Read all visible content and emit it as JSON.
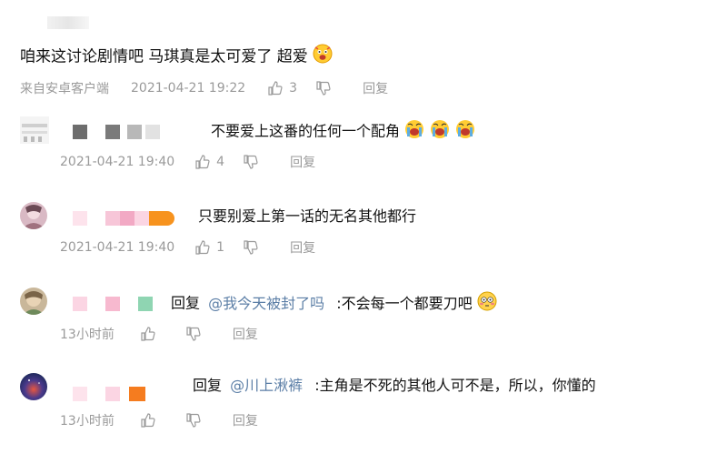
{
  "top_comment": {
    "text": "咱来这讨论剧情吧 马琪真是太可爱了 超爱",
    "emoji": "excited-face-emoji",
    "source": "来自安卓客户端",
    "time": "2021-04-21 19:22",
    "likes": "3",
    "reply_label": "回复"
  },
  "replies": [
    {
      "text": "不要爱上这番的任何一个配角",
      "emoji": "crying-face-emoji",
      "time": "2021-04-21 19:40",
      "likes": "4",
      "reply_label": "回复"
    },
    {
      "text": "只要别爱上第一话的无名其他都行",
      "time": "2021-04-21 19:40",
      "likes": "1",
      "reply_label": "回复"
    },
    {
      "prefix": "回复",
      "mention": "@我今天被封了吗",
      "text": ":不会每一个都要刀吧",
      "emoji": "flushed-face-emoji",
      "time": "13小时前",
      "reply_label": "回复"
    },
    {
      "prefix": "回复",
      "mention": "@川上湫裤",
      "text": ":主角是不死的其他人可不是，所以，你懂的",
      "time": "13小时前",
      "reply_label": "回复"
    }
  ],
  "colors": {
    "meta": "#9a9a9a",
    "mention": "#5b7ea6",
    "text": "#111111"
  }
}
